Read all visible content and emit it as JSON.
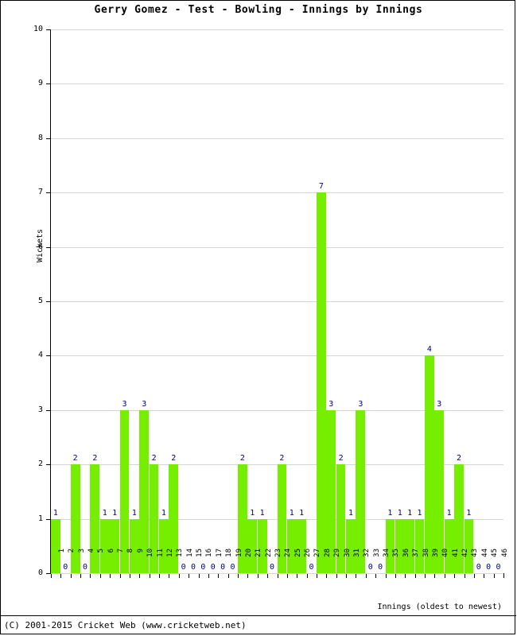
{
  "chart_data": {
    "type": "bar",
    "title": "Gerry Gomez - Test - Bowling - Innings by Innings",
    "xlabel": "Innings (oldest to newest)",
    "ylabel": "Wickets",
    "ylim": [
      0,
      10
    ],
    "ytick_labels": [
      "0",
      "1",
      "2",
      "3",
      "4",
      "5",
      "6",
      "7",
      "8",
      "9",
      "10"
    ],
    "grid": true,
    "legend": "none",
    "bar_color": "#76EE00",
    "value_label_color": "#000080",
    "categories": [
      "1",
      "2",
      "3",
      "4",
      "5",
      "6",
      "7",
      "8",
      "9",
      "10",
      "11",
      "12",
      "13",
      "14",
      "15",
      "16",
      "17",
      "18",
      "19",
      "20",
      "21",
      "22",
      "23",
      "24",
      "25",
      "26",
      "27",
      "28",
      "29",
      "30",
      "31",
      "32",
      "33",
      "34",
      "35",
      "36",
      "37",
      "38",
      "39",
      "40",
      "41",
      "42",
      "43",
      "44",
      "45",
      "46"
    ],
    "values": [
      1,
      0,
      2,
      0,
      2,
      1,
      1,
      3,
      1,
      3,
      2,
      1,
      2,
      0,
      0,
      0,
      0,
      0,
      0,
      2,
      1,
      1,
      0,
      2,
      1,
      1,
      0,
      7,
      3,
      2,
      1,
      3,
      0,
      0,
      1,
      1,
      1,
      1,
      4,
      3,
      1,
      2,
      1,
      0,
      0,
      0
    ]
  },
  "footer": {
    "text": "(C) 2001-2015 Cricket Web (www.cricketweb.net)"
  }
}
